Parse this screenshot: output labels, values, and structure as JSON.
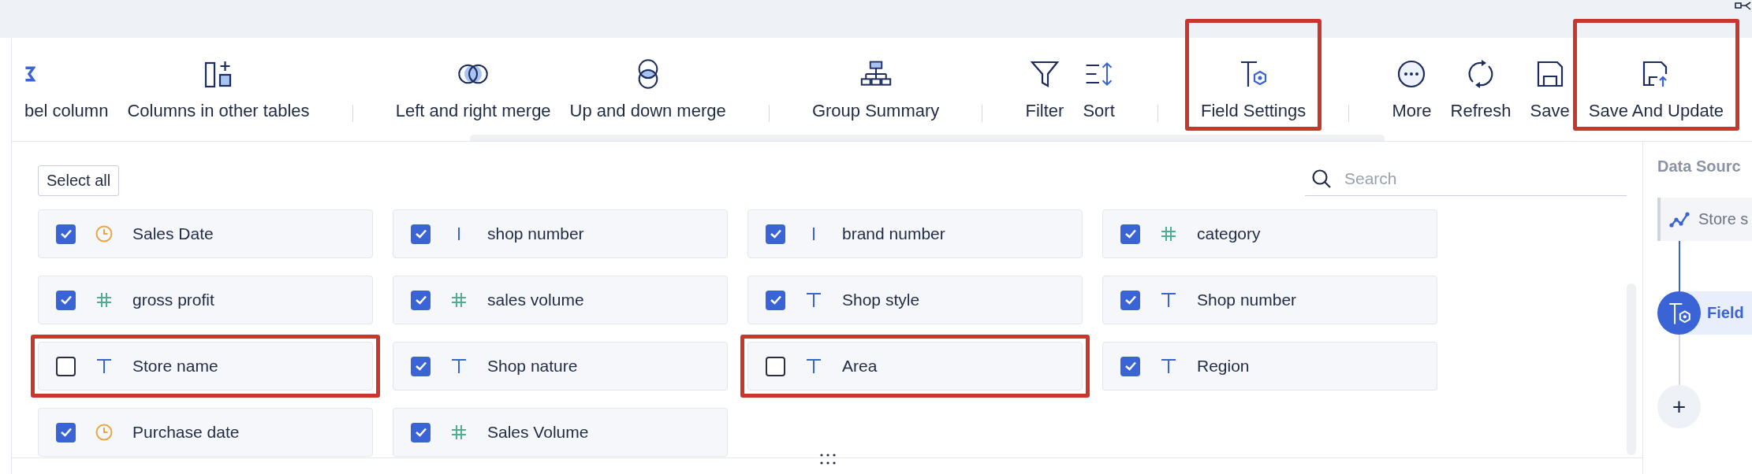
{
  "toolbar": {
    "groups": [
      {
        "items": [
          {
            "label": "bel column",
            "highlighted": false
          },
          {
            "label": "Columns in other tables",
            "highlighted": false
          }
        ]
      },
      {
        "items": [
          {
            "label": "Left and right merge",
            "highlighted": false
          },
          {
            "label": "Up and down merge",
            "highlighted": false
          }
        ]
      },
      {
        "items": [
          {
            "label": "Group Summary",
            "highlighted": false
          }
        ]
      },
      {
        "items": [
          {
            "label": "Filter",
            "highlighted": false
          },
          {
            "label": "Sort",
            "highlighted": false
          }
        ]
      },
      {
        "items": [
          {
            "label": "Field Settings",
            "highlighted": true
          }
        ]
      },
      {
        "items": [
          {
            "label": "More",
            "highlighted": false
          },
          {
            "label": "Refresh",
            "highlighted": false
          },
          {
            "label": "Save",
            "highlighted": false
          },
          {
            "label": "Save And Update",
            "highlighted": true
          }
        ]
      }
    ]
  },
  "fields_panel": {
    "select_all": "Select all",
    "search": {
      "placeholder": "Search"
    },
    "fields": [
      {
        "label": "Sales Date",
        "kind": "date",
        "checked": true,
        "highlighted": false
      },
      {
        "label": "shop number",
        "kind": "id",
        "checked": true,
        "highlighted": false
      },
      {
        "label": "brand number",
        "kind": "id",
        "checked": true,
        "highlighted": false
      },
      {
        "label": "category",
        "kind": "number",
        "checked": true,
        "highlighted": false
      },
      {
        "label": "gross profit",
        "kind": "number",
        "checked": true,
        "highlighted": false
      },
      {
        "label": "sales volume",
        "kind": "number",
        "checked": true,
        "highlighted": false
      },
      {
        "label": "Shop style",
        "kind": "text",
        "checked": true,
        "highlighted": false
      },
      {
        "label": "Shop number",
        "kind": "text",
        "checked": true,
        "highlighted": false
      },
      {
        "label": "Store name",
        "kind": "text",
        "checked": false,
        "highlighted": true
      },
      {
        "label": "Shop nature",
        "kind": "text",
        "checked": true,
        "highlighted": false
      },
      {
        "label": "Area",
        "kind": "text",
        "checked": false,
        "highlighted": true
      },
      {
        "label": "Region",
        "kind": "text",
        "checked": true,
        "highlighted": false
      },
      {
        "label": "Purchase date",
        "kind": "date",
        "checked": true,
        "highlighted": false
      },
      {
        "label": "Sales Volume",
        "kind": "number",
        "checked": true,
        "highlighted": false
      }
    ]
  },
  "sidebar": {
    "title": "Data Sourc",
    "steps": [
      {
        "label": "Store s",
        "kind": "source",
        "selected": false
      },
      {
        "label": "Field",
        "kind": "field-settings",
        "selected": true
      }
    ],
    "add_button": "+"
  }
}
